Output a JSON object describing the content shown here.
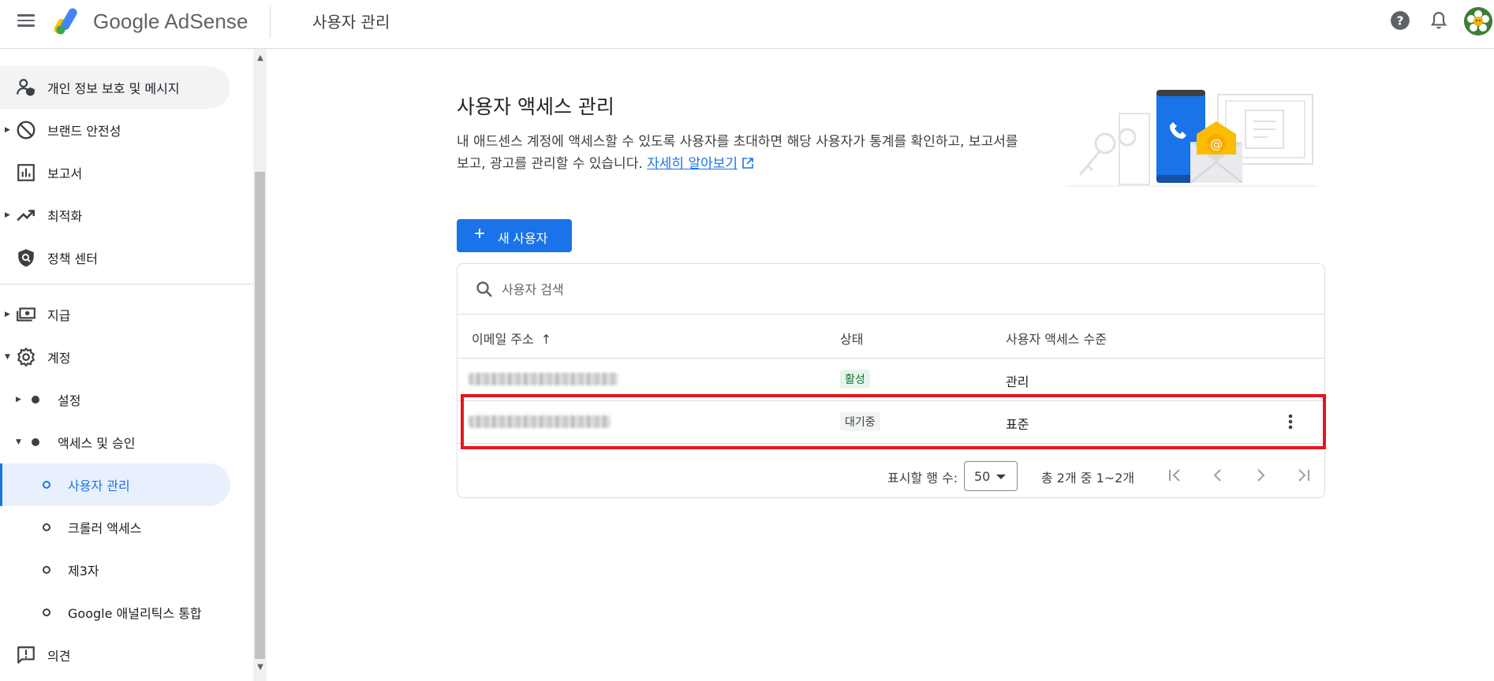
{
  "topbar": {
    "brand": "Google AdSense",
    "page_title": "사용자 관리",
    "icons": [
      "menu-icon",
      "help-icon",
      "notifications-icon",
      "avatar"
    ]
  },
  "sidebar": {
    "items": [
      {
        "label": "개인 정보 보호 및 메시지",
        "icon": "privacy-person-icon"
      },
      {
        "label": "브랜드 안전성",
        "icon": "block-icon"
      },
      {
        "label": "보고서",
        "icon": "report-chart-icon"
      },
      {
        "label": "최적화",
        "icon": "trending-up-icon"
      },
      {
        "label": "정책 센터",
        "icon": "policy-shield-icon"
      },
      {
        "label": "지급",
        "icon": "payments-icon"
      },
      {
        "label": "계정",
        "icon": "settings-gear-icon"
      },
      {
        "label": "설정"
      },
      {
        "label": "액세스 및 승인"
      },
      {
        "label": "사용자 관리"
      },
      {
        "label": "크롤러 액세스"
      },
      {
        "label": "제3자"
      },
      {
        "label": "Google 애널리틱스 통합"
      },
      {
        "label": "의견",
        "icon": "feedback-icon"
      }
    ]
  },
  "main": {
    "heading": "사용자 액세스 관리",
    "description": "내 애드센스 계정에 액세스할 수 있도록 사용자를 초대하면 해당 사용자가 통계를 확인하고, 보고서를 보고, 광고를 관리할 수 있습니다.",
    "learn_more": "자세히 알아보기",
    "new_user_button": "새 사용자",
    "search_placeholder": "사용자 검색",
    "columns": {
      "email": "이메일 주소",
      "status": "상태",
      "level": "사용자 액세스 수준"
    },
    "rows": [
      {
        "status": "활성",
        "level": "관리"
      },
      {
        "status": "대기중",
        "level": "표준"
      }
    ],
    "pager": {
      "rows_label": "표시할 행 수:",
      "rows_value": "50",
      "range": "총 2개 중 1~2개"
    }
  },
  "colors": {
    "accent": "#1a73e8",
    "highlight": "#e8141c",
    "active_chip_bg": "#e6f4ea",
    "active_chip_text": "#137333"
  }
}
